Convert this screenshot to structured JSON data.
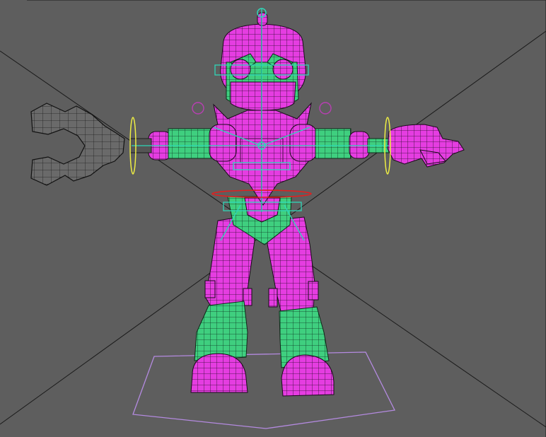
{
  "viewport": {
    "label": "",
    "background_color": "#5e5e5e"
  },
  "colors": {
    "mesh_magenta": "#e53de1",
    "mesh_green": "#3fcf7f",
    "mesh_gray": "#6a6a6a",
    "wire_line": "#151515",
    "joint_cyan": "#2fd7b7",
    "ring_yellow": "#eeee44",
    "ring_red": "#e02020",
    "pole_magenta": "#b83fb3",
    "base_outline": "#b48ae0",
    "perspective_line": "#1a1a1a"
  },
  "model": {
    "name": "",
    "parts": [
      "head",
      "torso",
      "left-arm",
      "right-arm",
      "claw-hand",
      "open-hand",
      "hips",
      "left-leg",
      "right-leg",
      "left-boot",
      "right-boot"
    ]
  },
  "rig": {
    "controls": [
      "head-joint",
      "spine-joint",
      "left-wrist-ring",
      "right-wrist-ring",
      "hip-ring",
      "left-pole-vector",
      "right-pole-vector",
      "ground-control"
    ]
  }
}
